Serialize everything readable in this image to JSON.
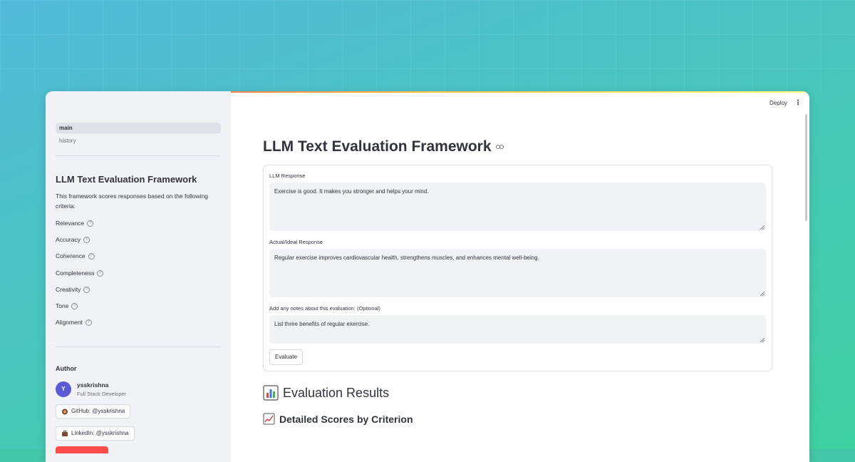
{
  "nav": {
    "items": [
      {
        "label": "main",
        "active": true
      },
      {
        "label": "history",
        "active": false
      }
    ]
  },
  "sidebar": {
    "title": "LLM Text Evaluation Framework",
    "description": "This framework scores responses based on the following criteria:",
    "criteria": [
      "Relevance",
      "Accuracy",
      "Coherence",
      "Completeness",
      "Creativity",
      "Tone",
      "Alignment"
    ],
    "help_glyph": "?",
    "author_heading": "Author",
    "author": {
      "initial": "Y",
      "name": "ysskrishna",
      "role": "Full Stack Developer",
      "github_label": "GitHub: @ysskrishna",
      "linkedin_label": "LinkedIn: @ysskrishna"
    }
  },
  "header": {
    "deploy_label": "Deploy",
    "menu_glyph": "⋮"
  },
  "main": {
    "title": "LLM Text Evaluation Framework",
    "form": {
      "llm_label": "LLM Response",
      "llm_value": "Exercise is good. It makes you stronger and helps your mind.",
      "ideal_label": "Actual/Ideal Response",
      "ideal_value": "Regular exercise improves cardiovascular health, strengthens muscles, and enhances mental well-being.",
      "notes_label": "Add any notes about this evaluation: (Optional)",
      "notes_value": "List three benefits of regular exercise.",
      "evaluate_label": "Evaluate"
    },
    "results_heading": "Evaluation Results",
    "detailed_heading": "Detailed Scores by Criterion"
  },
  "colors": {
    "accent": "#ff4b4b",
    "sidebar_bg": "#f0f2f6",
    "text": "#31333f",
    "avatar": "#5b5bd6"
  }
}
